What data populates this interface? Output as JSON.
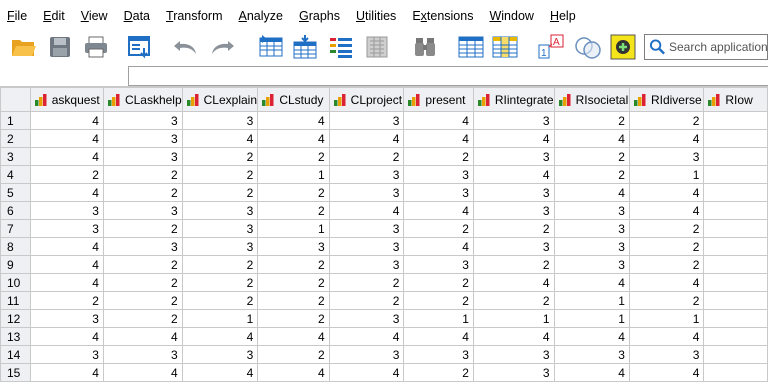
{
  "menu": [
    "File",
    "Edit",
    "View",
    "Data",
    "Transform",
    "Analyze",
    "Graphs",
    "Utilities",
    "Extensions",
    "Window",
    "Help"
  ],
  "menu_mnemonic_index": [
    0,
    0,
    0,
    0,
    0,
    0,
    0,
    0,
    1,
    0,
    0
  ],
  "toolbar": {
    "icons": [
      "open-icon",
      "save-icon",
      "print-icon",
      "dialog-recall-icon",
      "undo-icon",
      "redo-icon",
      "goto-case-icon",
      "goto-variable-icon",
      "variables-icon",
      "run-descriptives-icon",
      "find-icon",
      "insert-cases-icon",
      "insert-variable-icon",
      "split-file-icon",
      "value-labels-icon",
      "use-variable-sets-icon",
      "show-all-variables-icon"
    ],
    "search_placeholder": "Search application"
  },
  "grid": {
    "columns": [
      "askquest",
      "CLaskhelp",
      "CLexplain",
      "CLstudy",
      "CLproject",
      "present",
      "RIintegrate",
      "RIsocietal",
      "RIdiverse",
      "RIow"
    ],
    "rows": [
      {
        "n": "1",
        "v": [
          "4",
          "3",
          "3",
          "4",
          "3",
          "4",
          "3",
          "2",
          "2"
        ]
      },
      {
        "n": "2",
        "v": [
          "4",
          "3",
          "4",
          "4",
          "4",
          "4",
          "4",
          "4",
          "4"
        ]
      },
      {
        "n": "3",
        "v": [
          "4",
          "3",
          "2",
          "2",
          "2",
          "2",
          "3",
          "2",
          "3"
        ]
      },
      {
        "n": "4",
        "v": [
          "2",
          "2",
          "2",
          "1",
          "3",
          "3",
          "4",
          "2",
          "1"
        ]
      },
      {
        "n": "5",
        "v": [
          "4",
          "2",
          "2",
          "2",
          "3",
          "3",
          "3",
          "4",
          "4"
        ]
      },
      {
        "n": "6",
        "v": [
          "3",
          "3",
          "3",
          "2",
          "4",
          "4",
          "3",
          "3",
          "4"
        ]
      },
      {
        "n": "7",
        "v": [
          "3",
          "2",
          "3",
          "1",
          "3",
          "2",
          "2",
          "3",
          "2"
        ]
      },
      {
        "n": "8",
        "v": [
          "4",
          "3",
          "3",
          "3",
          "3",
          "4",
          "3",
          "3",
          "2"
        ]
      },
      {
        "n": "9",
        "v": [
          "4",
          "2",
          "2",
          "2",
          "3",
          "3",
          "2",
          "3",
          "2"
        ]
      },
      {
        "n": "10",
        "v": [
          "4",
          "2",
          "2",
          "2",
          "2",
          "2",
          "4",
          "4",
          "4"
        ]
      },
      {
        "n": "11",
        "v": [
          "2",
          "2",
          "2",
          "2",
          "2",
          "2",
          "2",
          "1",
          "2"
        ]
      },
      {
        "n": "12",
        "v": [
          "3",
          "2",
          "1",
          "2",
          "3",
          "1",
          "1",
          "1",
          "1"
        ]
      },
      {
        "n": "13",
        "v": [
          "4",
          "4",
          "4",
          "4",
          "4",
          "4",
          "4",
          "4",
          "4"
        ]
      },
      {
        "n": "14",
        "v": [
          "3",
          "3",
          "3",
          "2",
          "3",
          "3",
          "3",
          "3",
          "3"
        ]
      },
      {
        "n": "15",
        "v": [
          "4",
          "4",
          "4",
          "4",
          "4",
          "2",
          "3",
          "4",
          "4"
        ]
      }
    ]
  },
  "colors": {
    "header_bg": "#eef0f4",
    "gridline": "#c9c9c9",
    "accent_blue": "#1f6fc5"
  }
}
